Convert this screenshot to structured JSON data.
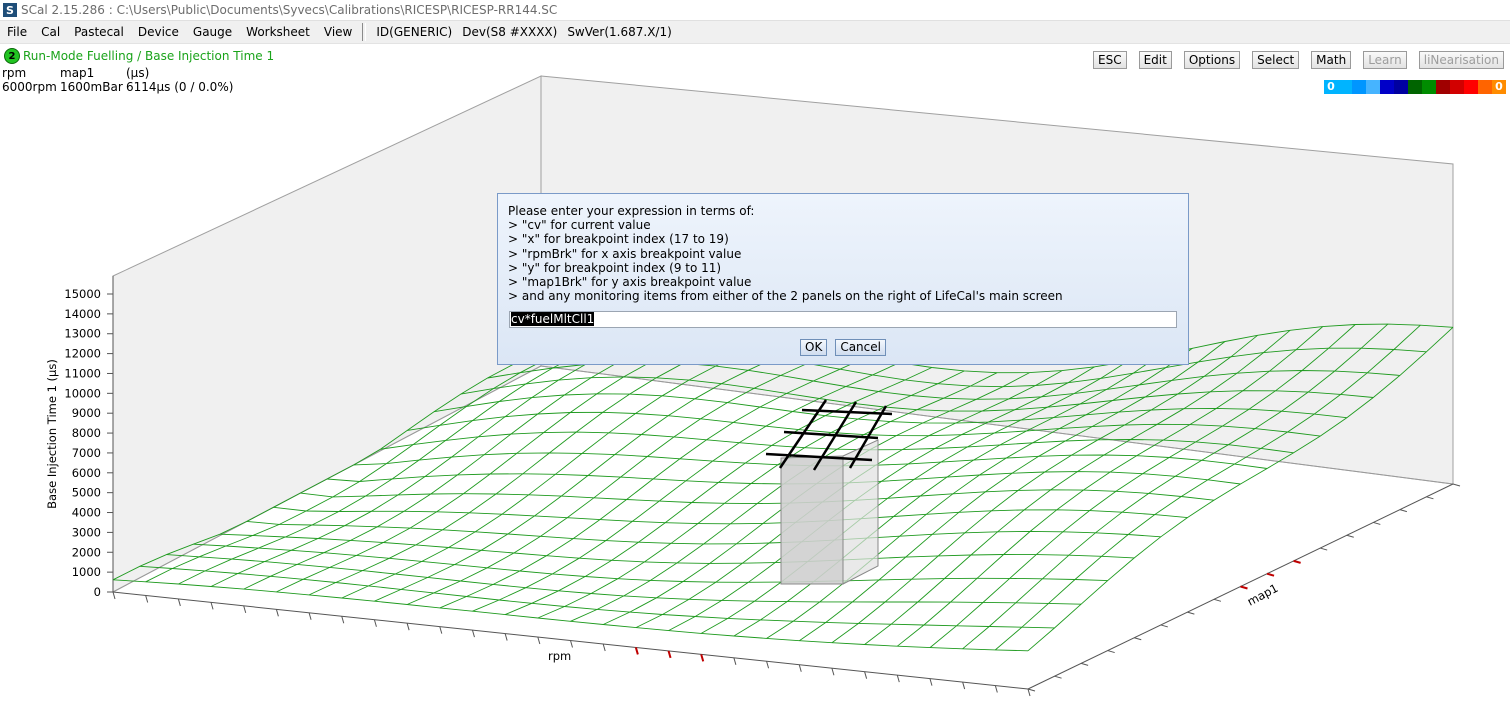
{
  "window": {
    "title": "SCal 2.15.286  :  C:\\Users\\Public\\Documents\\Syvecs\\Calibrations\\RICESP\\RICESP-RR144.SC"
  },
  "menu": [
    "File",
    "Cal",
    "Pastecal",
    "Device",
    "Gauge",
    "Worksheet",
    "View"
  ],
  "status": [
    "ID(GENERIC)",
    "Dev(S8 #XXXX)",
    "SwVer(1.687.X/1)"
  ],
  "mode": {
    "badge": "2",
    "title": "Run-Mode Fuelling / Base Injection Time 1"
  },
  "axes_header": {
    "x_name": "rpm",
    "y_name": "map1",
    "z_unit": "(µs)"
  },
  "cursor": {
    "x_value": "6000rpm",
    "y_value": "1600mBar",
    "z_value": "6114µs (0 / 0.0%)"
  },
  "toolbar": [
    {
      "label": "ESC",
      "enabled": true
    },
    {
      "label": "Edit",
      "enabled": true
    },
    {
      "label": "Options",
      "enabled": true
    },
    {
      "label": "Select",
      "enabled": true
    },
    {
      "label": "Math",
      "enabled": true
    },
    {
      "label": "Learn",
      "enabled": false
    },
    {
      "label": "liNearisation",
      "enabled": false
    }
  ],
  "colorbar": {
    "min_label": "0",
    "max_label": "0",
    "colors": [
      "#00b4ff",
      "#0096ff",
      "#46b4ff",
      "#0000c8",
      "#0000a0",
      "#006400",
      "#008c00",
      "#a00000",
      "#d20000",
      "#ff0000",
      "#ff6400"
    ],
    "end_colors": [
      "#00b4ff",
      "#ff8c00"
    ]
  },
  "plot": {
    "z_axis_label": "Base Injection Time 1 (µs)",
    "z_ticks": [
      "0",
      "1000",
      "2000",
      "3000",
      "4000",
      "5000",
      "6000",
      "7000",
      "8000",
      "9000",
      "10000",
      "11000",
      "12000",
      "13000",
      "14000",
      "15000"
    ],
    "x_axis_label": "rpm",
    "y_axis_label": "map1",
    "mesh_color": "#1f9a1f"
  },
  "dialog": {
    "lines": [
      "Please enter your expression in terms of:",
      "> \"cv\" for current value",
      "> \"x\" for breakpoint index (17 to 19)",
      "> \"rpmBrk\" for x axis breakpoint value",
      "> \"y\" for breakpoint index (9 to 11)",
      "> \"map1Brk\" for y axis breakpoint value",
      "> and any monitoring items from either of the 2 panels on the right of LifeCal's main screen"
    ],
    "input_value": "cv*fuelMltCll1",
    "ok_label": "OK",
    "cancel_label": "Cancel"
  }
}
